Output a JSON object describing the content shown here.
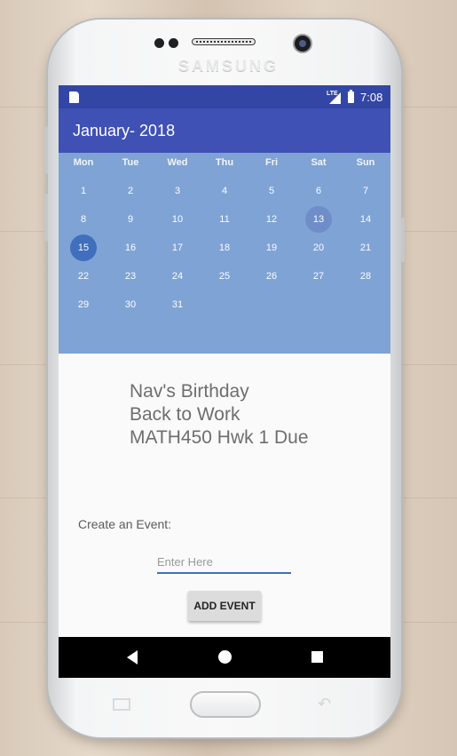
{
  "device": {
    "brand": "SAMSUNG"
  },
  "status_bar": {
    "network": "LTE",
    "time": "7:08"
  },
  "app_bar": {
    "title": "January- 2018"
  },
  "calendar": {
    "weekdays": [
      "Mon",
      "Tue",
      "Wed",
      "Thu",
      "Fri",
      "Sat",
      "Sun"
    ],
    "weeks": [
      [
        "1",
        "2",
        "3",
        "4",
        "5",
        "6",
        "7"
      ],
      [
        "8",
        "9",
        "10",
        "11",
        "12",
        "13",
        "14"
      ],
      [
        "15",
        "16",
        "17",
        "18",
        "19",
        "20",
        "21"
      ],
      [
        "22",
        "23",
        "24",
        "25",
        "26",
        "27",
        "28"
      ],
      [
        "29",
        "30",
        "31",
        "",
        "",
        "",
        ""
      ]
    ],
    "selected_day": "15",
    "marked_day": "13",
    "colors": {
      "background": "#7fa3d5",
      "selected": "#3f6fbd",
      "marked": "#6f8ec9"
    }
  },
  "events": [
    "Nav's Birthday",
    "Back to Work",
    "MATH450 Hwk 1 Due"
  ],
  "create_event": {
    "label": "Create an Event:",
    "placeholder": "Enter Here",
    "value": "",
    "button_label": "ADD EVENT"
  },
  "colors": {
    "primary": "#3f51b5",
    "status_bar": "#3446a5",
    "accent": "#3f6fbd"
  },
  "nav_bar": {
    "icons": [
      "back-icon",
      "home-icon",
      "recent-apps-icon"
    ]
  }
}
